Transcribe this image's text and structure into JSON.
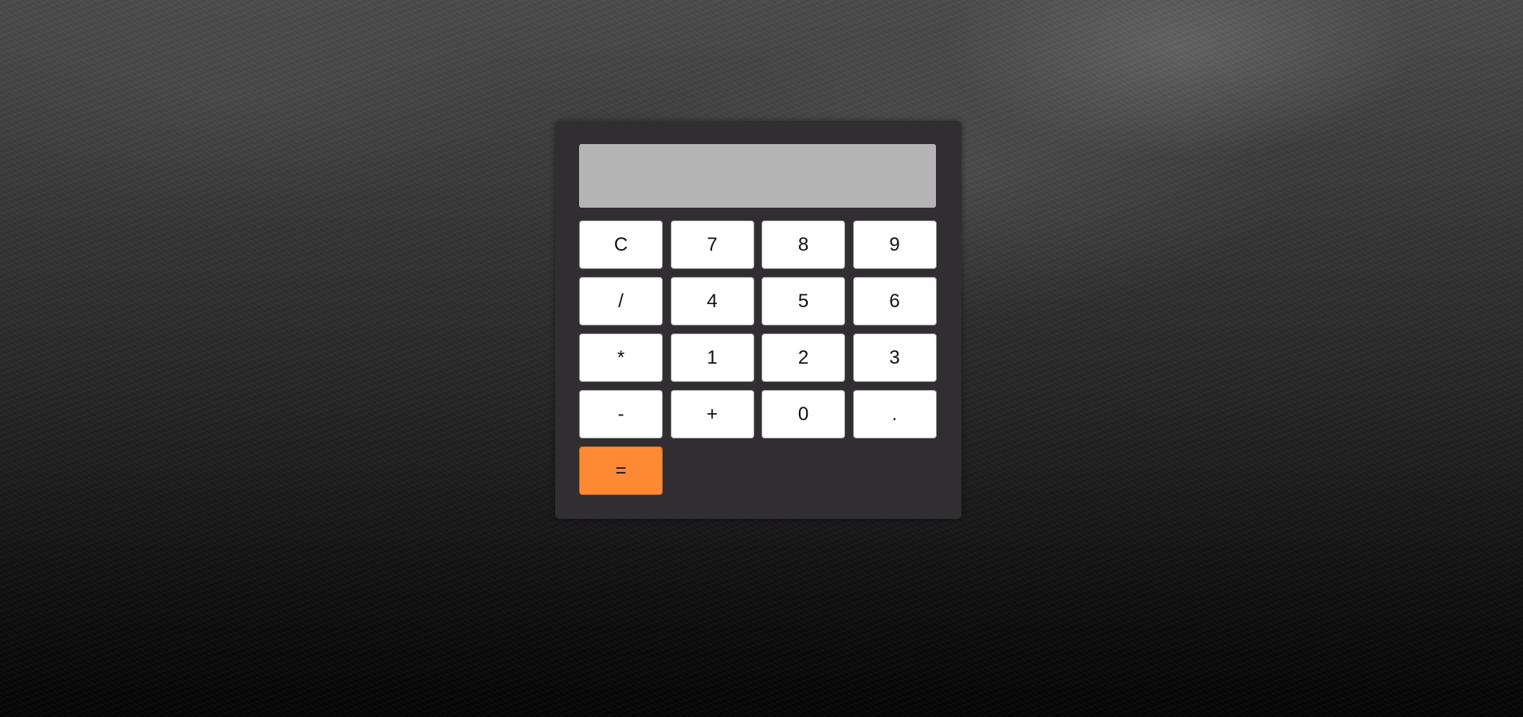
{
  "display": {
    "value": ""
  },
  "keys": {
    "clear": "C",
    "seven": "7",
    "eight": "8",
    "nine": "9",
    "divide": "/",
    "four": "4",
    "five": "5",
    "six": "6",
    "multiply": "*",
    "one": "1",
    "two": "2",
    "three": "3",
    "subtract": "-",
    "add": "+",
    "zero": "0",
    "decimal": ".",
    "equals": "="
  },
  "colors": {
    "calculator_body": "#302e31",
    "display_background": "#b4b4b4",
    "key_background": "#ffffff",
    "equals_key_background": "#ff8a33"
  }
}
